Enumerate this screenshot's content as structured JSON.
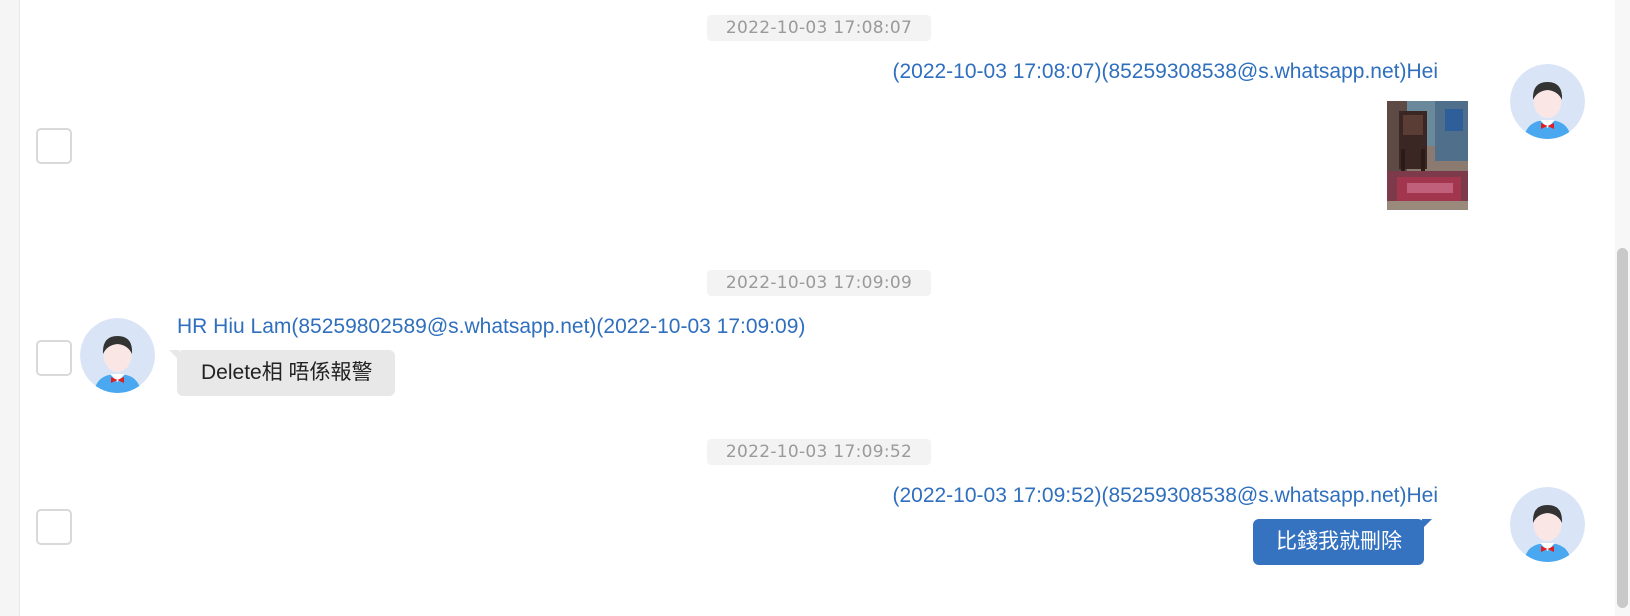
{
  "messages": [
    {
      "timestamp": "2022-10-03 17:08:07",
      "direction": "outgoing",
      "meta": "(2022-10-03 17:08:07)(85259308538@s.whatsapp.net)Hei",
      "type": "image",
      "icon": "image-thumbnail"
    },
    {
      "timestamp": "2022-10-03 17:09:09",
      "direction": "incoming",
      "meta": "HR Hiu Lam(85259802589@s.whatsapp.net)(2022-10-03 17:09:09)",
      "type": "text",
      "text": "Delete相 唔係報警"
    },
    {
      "timestamp": "2022-10-03 17:09:52",
      "direction": "outgoing",
      "meta": "(2022-10-03 17:09:52)(85259308538@s.whatsapp.net)Hei",
      "type": "text",
      "text": "比錢我就刪除"
    }
  ],
  "colors": {
    "accent": "#3572c0",
    "meta_text": "#2f6fbd",
    "incoming_bubble": "#e8e8e8",
    "timestamp_bg": "#f3f3f3",
    "avatar_bg": "#d9e5f6",
    "avatar_shirt": "#4aa8f0",
    "avatar_bowtie": "#e02020"
  },
  "icons": {
    "avatar": "user-avatar-icon",
    "checkbox": "select-checkbox"
  }
}
